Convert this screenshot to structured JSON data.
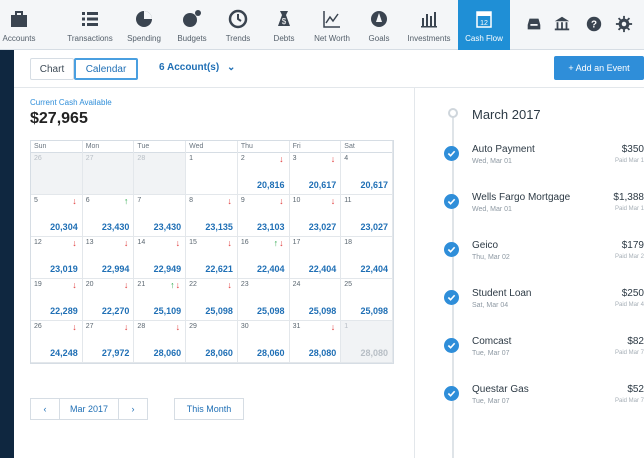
{
  "nav": {
    "items": [
      {
        "label": "Accounts",
        "icon": "briefcase-icon"
      },
      {
        "label": "Transactions",
        "icon": "list-icon"
      },
      {
        "label": "Spending",
        "icon": "pie-chart-icon"
      },
      {
        "label": "Budgets",
        "icon": "budgets-icon"
      },
      {
        "label": "Trends",
        "icon": "clock-icon"
      },
      {
        "label": "Debts",
        "icon": "money-bag-icon"
      },
      {
        "label": "Net Worth",
        "icon": "line-chart-icon"
      },
      {
        "label": "Goals",
        "icon": "compass-icon"
      },
      {
        "label": "Investments",
        "icon": "bar-chart-icon"
      },
      {
        "label": "Cash Flow",
        "icon": "calendar-icon",
        "badge": "12"
      }
    ],
    "right_icons": [
      "inbox-icon",
      "bank-icon",
      "help-icon",
      "gear-icon"
    ],
    "active_color": "#1f8fd6"
  },
  "toolbar": {
    "tab_chart": "Chart",
    "tab_calendar": "Calendar",
    "accounts": "6 Account(s)",
    "add_event": "+ Add an Event"
  },
  "cash": {
    "label": "Current Cash Available",
    "value": "$27,965"
  },
  "calendar": {
    "weekdays": [
      "Sun",
      "Mon",
      "Tue",
      "Wed",
      "Thu",
      "Fri",
      "Sat"
    ],
    "weeks": [
      [
        {
          "d": "26",
          "bal": "",
          "muted": true,
          "arrows": ""
        },
        {
          "d": "27",
          "bal": "",
          "muted": true,
          "arrows": ""
        },
        {
          "d": "28",
          "bal": "",
          "muted": true,
          "arrows": ""
        },
        {
          "d": "1",
          "bal": "",
          "muted": false,
          "arrows": ""
        },
        {
          "d": "2",
          "bal": "20,816",
          "muted": false,
          "arrows": "d"
        },
        {
          "d": "3",
          "bal": "20,617",
          "muted": false,
          "arrows": "d"
        },
        {
          "d": "4",
          "bal": "20,617",
          "muted": false,
          "arrows": ""
        }
      ],
      [
        {
          "d": "5",
          "bal": "20,304",
          "muted": false,
          "arrows": "d"
        },
        {
          "d": "6",
          "bal": "23,430",
          "muted": false,
          "arrows": "u"
        },
        {
          "d": "7",
          "bal": "23,430",
          "muted": false,
          "arrows": ""
        },
        {
          "d": "8",
          "bal": "23,135",
          "muted": false,
          "arrows": "d"
        },
        {
          "d": "9",
          "bal": "23,103",
          "muted": false,
          "arrows": "d"
        },
        {
          "d": "10",
          "bal": "23,027",
          "muted": false,
          "arrows": "d"
        },
        {
          "d": "11",
          "bal": "23,027",
          "muted": false,
          "arrows": ""
        }
      ],
      [
        {
          "d": "12",
          "bal": "23,019",
          "muted": false,
          "arrows": "d"
        },
        {
          "d": "13",
          "bal": "22,994",
          "muted": false,
          "arrows": "d"
        },
        {
          "d": "14",
          "bal": "22,949",
          "muted": false,
          "arrows": "d"
        },
        {
          "d": "15",
          "bal": "22,621",
          "muted": false,
          "arrows": "d"
        },
        {
          "d": "16",
          "bal": "22,404",
          "muted": false,
          "arrows": "ud"
        },
        {
          "d": "17",
          "bal": "22,404",
          "muted": false,
          "arrows": ""
        },
        {
          "d": "18",
          "bal": "22,404",
          "muted": false,
          "arrows": ""
        }
      ],
      [
        {
          "d": "19",
          "bal": "22,289",
          "muted": false,
          "arrows": "d"
        },
        {
          "d": "20",
          "bal": "22,270",
          "muted": false,
          "arrows": "d"
        },
        {
          "d": "21",
          "bal": "25,109",
          "muted": false,
          "arrows": "ud"
        },
        {
          "d": "22",
          "bal": "25,098",
          "muted": false,
          "arrows": "d"
        },
        {
          "d": "23",
          "bal": "25,098",
          "muted": false,
          "arrows": ""
        },
        {
          "d": "24",
          "bal": "25,098",
          "muted": false,
          "arrows": ""
        },
        {
          "d": "25",
          "bal": "25,098",
          "muted": false,
          "arrows": ""
        }
      ],
      [
        {
          "d": "26",
          "bal": "24,248",
          "muted": false,
          "arrows": "d"
        },
        {
          "d": "27",
          "bal": "27,972",
          "muted": false,
          "arrows": "d"
        },
        {
          "d": "28",
          "bal": "28,060",
          "muted": false,
          "arrows": "d"
        },
        {
          "d": "29",
          "bal": "28,060",
          "muted": false,
          "arrows": ""
        },
        {
          "d": "30",
          "bal": "28,060",
          "muted": false,
          "arrows": ""
        },
        {
          "d": "31",
          "bal": "28,080",
          "muted": false,
          "arrows": "d"
        },
        {
          "d": "1",
          "bal": "28,080",
          "muted": true,
          "arrows": ""
        }
      ]
    ]
  },
  "pager": {
    "prev": "‹",
    "month": "Mar 2017",
    "next": "›",
    "this_month": "This Month"
  },
  "timeline": {
    "month": "March 2017",
    "events": [
      {
        "name": "Auto Payment",
        "date": "Wed, Mar 01",
        "amount": "$350",
        "paid": "Paid Mar 1"
      },
      {
        "name": "Wells Fargo Mortgage",
        "date": "Wed, Mar 01",
        "amount": "$1,388",
        "paid": "Paid Mar 1"
      },
      {
        "name": "Geico",
        "date": "Thu, Mar 02",
        "amount": "$179",
        "paid": "Paid Mar 2"
      },
      {
        "name": "Student Loan",
        "date": "Sat, Mar 04",
        "amount": "$250",
        "paid": "Paid Mar 4"
      },
      {
        "name": "Comcast",
        "date": "Tue, Mar 07",
        "amount": "$82",
        "paid": "Paid Mar 7"
      },
      {
        "name": "Questar Gas",
        "date": "Tue, Mar 07",
        "amount": "$52",
        "paid": "Paid Mar 7"
      }
    ]
  }
}
